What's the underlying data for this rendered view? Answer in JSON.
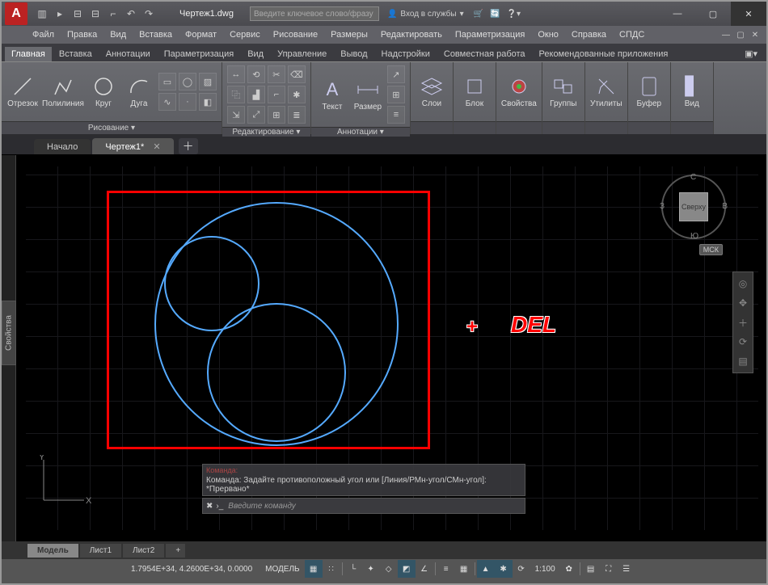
{
  "title": {
    "doc": "Чертеж1.dwg"
  },
  "search": {
    "placeholder": "Введите ключевое слово/фразу"
  },
  "signin": {
    "label": "Вход в службы"
  },
  "menus": [
    "Файл",
    "Правка",
    "Вид",
    "Вставка",
    "Формат",
    "Сервис",
    "Рисование",
    "Размеры",
    "Редактировать",
    "Параметризация",
    "Окно",
    "Справка",
    "СПДС"
  ],
  "tabs": [
    "Главная",
    "Вставка",
    "Аннотации",
    "Параметризация",
    "Вид",
    "Управление",
    "Вывод",
    "Надстройки",
    "Совместная работа",
    "Рекомендованные приложения"
  ],
  "tabs_active": 0,
  "panels": {
    "draw": {
      "title": "Рисование ▾",
      "btns": [
        "Отрезок",
        "Полилиния",
        "Круг",
        "Дуга"
      ]
    },
    "modify": {
      "title": "Редактирование ▾"
    },
    "annot": {
      "title": "Аннотации ▾",
      "btns": [
        "Текст",
        "Размер"
      ]
    },
    "layers": {
      "title": "",
      "btns": [
        "Слои"
      ]
    },
    "block": {
      "title": "",
      "btns": [
        "Блок"
      ]
    },
    "props": {
      "title": "",
      "btns": [
        "Свойства"
      ]
    },
    "groups": {
      "title": "",
      "btns": [
        "Группы"
      ]
    },
    "util": {
      "title": "",
      "btns": [
        "Утилиты"
      ]
    },
    "clip": {
      "title": "",
      "btns": [
        "Буфер"
      ]
    },
    "view": {
      "title": "",
      "btns": [
        "Вид"
      ]
    }
  },
  "doctabs": {
    "items": [
      "Начало",
      "Чертеж1*"
    ],
    "active": 1
  },
  "prop_tab": "Свойства",
  "viewcube": {
    "top": "Сверху",
    "n": "С",
    "s": "Ю",
    "w": "З",
    "e": "В",
    "wcs": "МСК"
  },
  "overlay": {
    "plus": "+",
    "del": "DEL"
  },
  "cmd": {
    "hist_head": "Команда:",
    "hist": "Команда: Задайте противоположный угол или [Линия/РМн-угол/СМн-угол]: *Прервано*",
    "placeholder": "Введите команду"
  },
  "layouts": {
    "items": [
      "Модель",
      "Лист1",
      "Лист2"
    ],
    "active": 0
  },
  "status": {
    "coords": "1.7954E+34, 4.2600E+34, 0.0000",
    "model": "МОДЕЛЬ",
    "scale": "1:100"
  }
}
